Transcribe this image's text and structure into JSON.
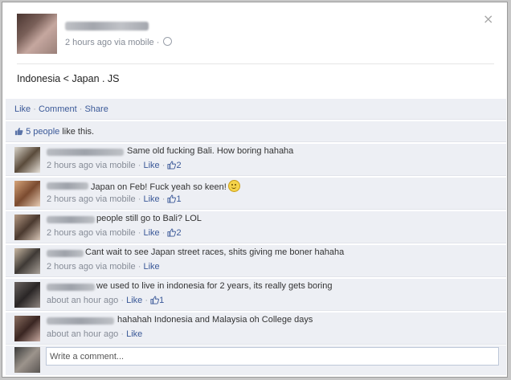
{
  "post": {
    "time": "2 hours ago via mobile",
    "dot": "·",
    "text": "Indonesia < Japan . JS"
  },
  "actions": {
    "like": "Like",
    "comment": "Comment",
    "share": "Share",
    "sep": "·"
  },
  "likes": {
    "count_text": "5 people",
    "suffix": " like this."
  },
  "comments": [
    {
      "text": "Same old fucking Bali. How boring hahaha",
      "meta": "2 hours ago via mobile",
      "like": "Like",
      "likes": "2"
    },
    {
      "text": "Japan on Feb! Fuck yeah so keen!",
      "meta": "2 hours ago via mobile",
      "like": "Like",
      "likes": "1"
    },
    {
      "text": "people still go to Bali? LOL",
      "meta": "2 hours ago via mobile",
      "like": "Like",
      "likes": "2"
    },
    {
      "text": "Cant wait to see Japan street races, shits giving me boner hahaha",
      "meta": "2 hours ago via mobile",
      "like": "Like",
      "likes": ""
    },
    {
      "text": "we used to live in indonesia for 2 years, its really gets boring",
      "meta": "about an hour ago",
      "like": "Like",
      "likes": "1"
    },
    {
      "text": "hahahah Indonesia and Malaysia oh College days",
      "meta": "about an hour ago",
      "like": "Like",
      "likes": ""
    }
  ],
  "composer": {
    "placeholder": "Write a comment..."
  },
  "icons": {
    "close": "close-icon",
    "globe": "globe-icon",
    "thumb": "thumbs-up-icon",
    "smiley": "smiley-icon"
  },
  "colors": {
    "link": "#3b5998",
    "panel": "#edeff4",
    "meta": "#858b96"
  }
}
